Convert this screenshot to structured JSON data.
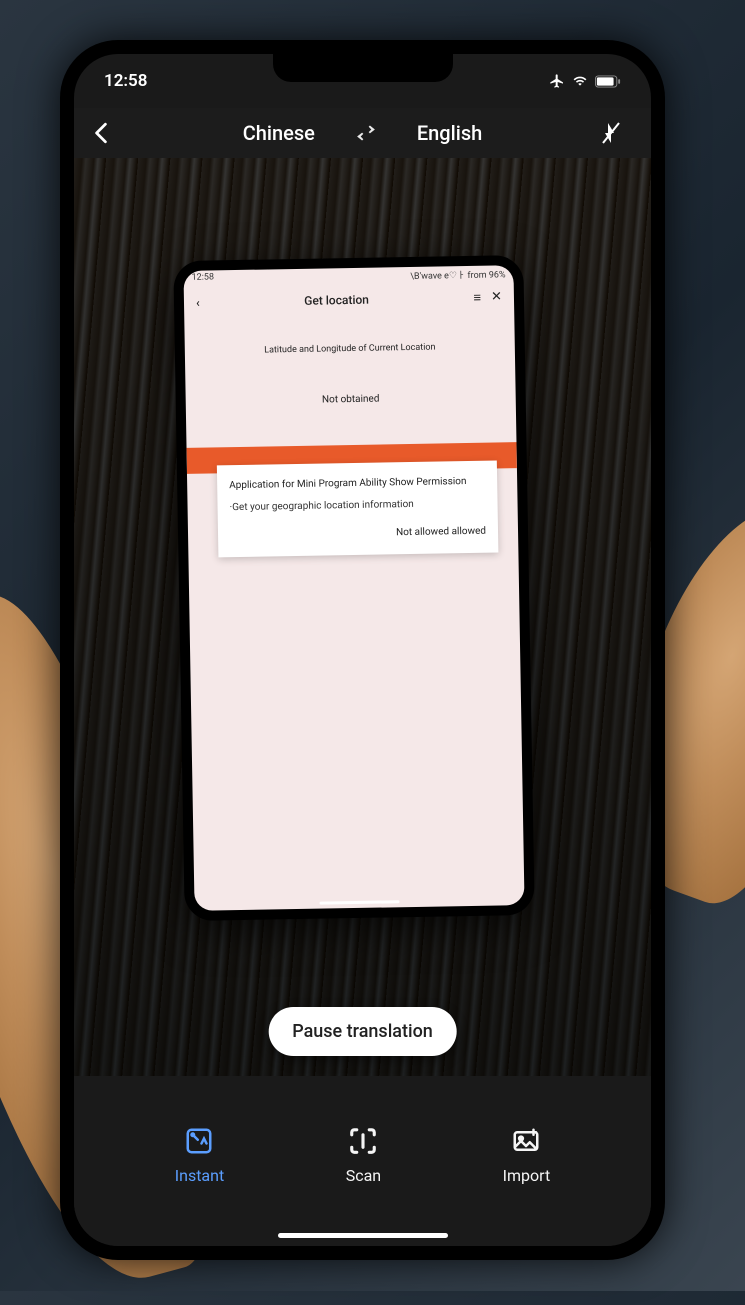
{
  "status_bar": {
    "time": "12:58"
  },
  "header": {
    "source_lang": "Chinese",
    "target_lang": "English"
  },
  "inner_phone": {
    "status": {
      "time": "12:58",
      "right": "\\B'wave  e♡ㅏ from  96%"
    },
    "title": "Get  location",
    "line1": "Latitude and Longitude of Current Location",
    "line2": "Not  obtained",
    "dialog": {
      "title": "Application  for  Mini  Program  Ability  Show Permission",
      "desc": "·Get  your  geographic  location  information",
      "actions": "Not  allowed  allowed"
    }
  },
  "pause_button": "Pause translation",
  "tabs": {
    "instant": "Instant",
    "scan": "Scan",
    "import": "Import"
  },
  "colors": {
    "accent": "#5b9eff",
    "orange": "#e85a2a"
  }
}
